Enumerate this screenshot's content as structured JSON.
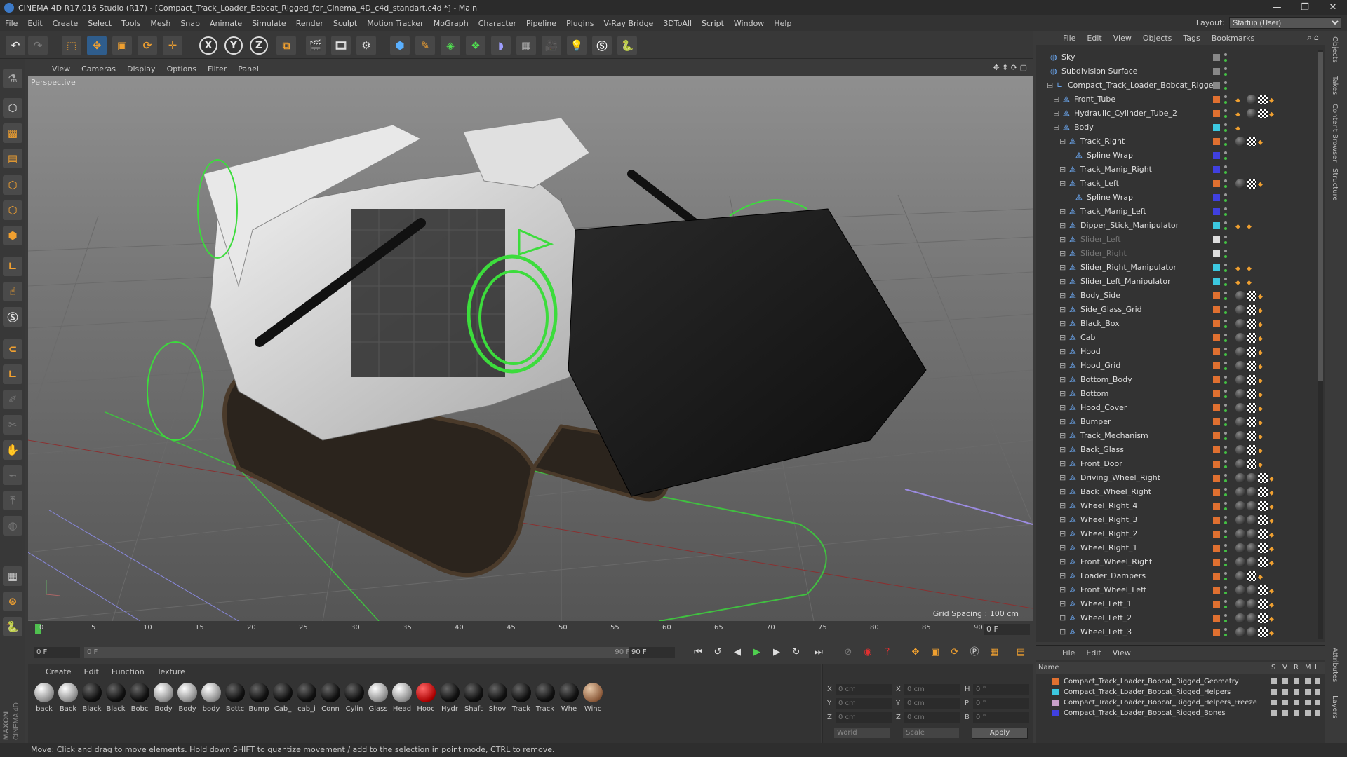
{
  "window": {
    "title": "CINEMA 4D R17.016 Studio (R17) - [Compact_Track_Loader_Bobcat_Rigged_for_Cinema_4D_c4d_standart.c4d *] - Main",
    "controls": [
      "—",
      "❐",
      "✕"
    ]
  },
  "menubar": {
    "items": [
      "File",
      "Edit",
      "Create",
      "Select",
      "Tools",
      "Mesh",
      "Snap",
      "Animate",
      "Simulate",
      "Render",
      "Sculpt",
      "Motion Tracker",
      "MoGraph",
      "Character",
      "Pipeline",
      "Plugins",
      "V-Ray Bridge",
      "3DToAll",
      "Script",
      "Window",
      "Help"
    ],
    "layout_label": "Layout:",
    "layout_value": "Startup (User)"
  },
  "toolbar": {
    "axis_x": "X",
    "axis_y": "Y",
    "axis_z": "Z"
  },
  "viewport": {
    "menu": [
      "View",
      "Cameras",
      "Display",
      "Options",
      "Filter",
      "Panel"
    ],
    "label": "Perspective",
    "grid_spacing": "Grid Spacing : 100 cm"
  },
  "timeline": {
    "ticks": [
      "0",
      "5",
      "10",
      "15",
      "20",
      "25",
      "30",
      "35",
      "40",
      "45",
      "50",
      "55",
      "60",
      "65",
      "70",
      "75",
      "80",
      "85",
      "90"
    ],
    "current_frame": "0 F",
    "start_field": "0 F",
    "range_start": "0 F",
    "range_end": "90 F",
    "end_field": "90 F"
  },
  "materials": {
    "menu": [
      "Create",
      "Edit",
      "Function",
      "Texture"
    ],
    "items": [
      {
        "name": "back",
        "style": "light"
      },
      {
        "name": "Back",
        "style": "light"
      },
      {
        "name": "Black",
        "style": "dark"
      },
      {
        "name": "Black",
        "style": "dark"
      },
      {
        "name": "Bobc",
        "style": "dark"
      },
      {
        "name": "Body",
        "style": "light"
      },
      {
        "name": "Body",
        "style": "light"
      },
      {
        "name": "body",
        "style": "light"
      },
      {
        "name": "Bottc",
        "style": "dark"
      },
      {
        "name": "Bump",
        "style": "dark"
      },
      {
        "name": "Cab_",
        "style": "dark"
      },
      {
        "name": "cab_i",
        "style": "dark"
      },
      {
        "name": "Conn",
        "style": "dark"
      },
      {
        "name": "Cylin",
        "style": "dark"
      },
      {
        "name": "Glass",
        "style": "light"
      },
      {
        "name": "Head",
        "style": "light"
      },
      {
        "name": "Hooc",
        "style": "red"
      },
      {
        "name": "Hydr",
        "style": "dark"
      },
      {
        "name": "Shaft",
        "style": "dark"
      },
      {
        "name": "Shov",
        "style": "dark"
      },
      {
        "name": "Track",
        "style": "dark"
      },
      {
        "name": "Track",
        "style": "dark"
      },
      {
        "name": "Whe",
        "style": "dark"
      },
      {
        "name": "Winc",
        "style": "skin"
      }
    ]
  },
  "coords": {
    "x_label": "X",
    "y_label": "Y",
    "z_label": "Z",
    "x2_label": "X",
    "y2_label": "Y",
    "z2_label": "Z",
    "h_label": "H",
    "p_label": "P",
    "b_label": "B",
    "x": "0 cm",
    "y": "0 cm",
    "z": "0 cm",
    "sx": "0 cm",
    "sy": "0 cm",
    "sz": "0 cm",
    "h": "0 °",
    "p": "0 °",
    "b": "0 °",
    "mode": "World",
    "scale": "Scale",
    "apply": "Apply"
  },
  "objects": {
    "menu": [
      "File",
      "Edit",
      "View",
      "Objects",
      "Tags",
      "Bookmarks"
    ],
    "rows": [
      {
        "label": "Sky",
        "indent": 0,
        "dim": false,
        "color": "#888888",
        "tags": []
      },
      {
        "label": "Subdivision Surface",
        "indent": 0,
        "dim": false,
        "color": "#888888",
        "tags": []
      },
      {
        "label": "Compact_Track_Loader_Bobcat_Rigged",
        "indent": 1,
        "dim": false,
        "color": "#888888",
        "tags": []
      },
      {
        "label": "Front_Tube",
        "indent": 2,
        "dim": false,
        "color": "#e07030",
        "tags": [
          "tri",
          "ball",
          "ck",
          "tri"
        ]
      },
      {
        "label": "Hydraulic_Cylinder_Tube_2",
        "indent": 2,
        "dim": false,
        "color": "#e07030",
        "tags": [
          "tri",
          "ball",
          "ck",
          "tri"
        ]
      },
      {
        "label": "Body",
        "indent": 2,
        "dim": false,
        "color": "#3cc8e0",
        "tags": [
          "tri"
        ]
      },
      {
        "label": "Track_Right",
        "indent": 3,
        "dim": false,
        "color": "#e07030",
        "tags": [
          "ball",
          "ck",
          "tri"
        ]
      },
      {
        "label": "Spline Wrap",
        "indent": 4,
        "dim": false,
        "color": "#4040e0",
        "tags": []
      },
      {
        "label": "Track_Manip_Right",
        "indent": 3,
        "dim": false,
        "color": "#4040e0",
        "tags": []
      },
      {
        "label": "Track_Left",
        "indent": 3,
        "dim": false,
        "color": "#e07030",
        "tags": [
          "ball",
          "ck",
          "tri"
        ]
      },
      {
        "label": "Spline Wrap",
        "indent": 4,
        "dim": false,
        "color": "#4040e0",
        "tags": []
      },
      {
        "label": "Track_Manip_Left",
        "indent": 3,
        "dim": false,
        "color": "#4040e0",
        "tags": []
      },
      {
        "label": "Dipper_Stick_Manipulator",
        "indent": 3,
        "dim": false,
        "color": "#3cc8e0",
        "tags": [
          "tri",
          "tri"
        ]
      },
      {
        "label": "Slider_Left",
        "indent": 3,
        "dim": true,
        "color": "#dddddd",
        "tags": []
      },
      {
        "label": "Slider_Right",
        "indent": 3,
        "dim": true,
        "color": "#dddddd",
        "tags": []
      },
      {
        "label": "Slider_Right_Manipulator",
        "indent": 3,
        "dim": false,
        "color": "#3cc8e0",
        "tags": [
          "tri",
          "tri"
        ]
      },
      {
        "label": "Slider_Left_Manipulator",
        "indent": 3,
        "dim": false,
        "color": "#3cc8e0",
        "tags": [
          "tri",
          "tri"
        ]
      },
      {
        "label": "Body_Side",
        "indent": 3,
        "dim": false,
        "color": "#e07030",
        "tags": [
          "ball",
          "ck",
          "tri"
        ]
      },
      {
        "label": "Side_Glass_Grid",
        "indent": 3,
        "dim": false,
        "color": "#e07030",
        "tags": [
          "ball",
          "ck",
          "tri"
        ]
      },
      {
        "label": "Black_Box",
        "indent": 3,
        "dim": false,
        "color": "#e07030",
        "tags": [
          "ball",
          "ck",
          "tri"
        ]
      },
      {
        "label": "Cab",
        "indent": 3,
        "dim": false,
        "color": "#e07030",
        "tags": [
          "ball",
          "ck",
          "tri"
        ]
      },
      {
        "label": "Hood",
        "indent": 3,
        "dim": false,
        "color": "#e07030",
        "tags": [
          "ball",
          "ck",
          "tri"
        ]
      },
      {
        "label": "Hood_Grid",
        "indent": 3,
        "dim": false,
        "color": "#e07030",
        "tags": [
          "ball",
          "ck",
          "tri"
        ]
      },
      {
        "label": "Bottom_Body",
        "indent": 3,
        "dim": false,
        "color": "#e07030",
        "tags": [
          "ball",
          "ck",
          "tri"
        ]
      },
      {
        "label": "Bottom",
        "indent": 3,
        "dim": false,
        "color": "#e07030",
        "tags": [
          "ball",
          "ck",
          "tri"
        ]
      },
      {
        "label": "Hood_Cover",
        "indent": 3,
        "dim": false,
        "color": "#e07030",
        "tags": [
          "ball",
          "ck",
          "tri"
        ]
      },
      {
        "label": "Bumper",
        "indent": 3,
        "dim": false,
        "color": "#e07030",
        "tags": [
          "ball",
          "ck",
          "tri"
        ]
      },
      {
        "label": "Track_Mechanism",
        "indent": 3,
        "dim": false,
        "color": "#e07030",
        "tags": [
          "ball",
          "ck",
          "tri"
        ]
      },
      {
        "label": "Back_Glass",
        "indent": 3,
        "dim": false,
        "color": "#e07030",
        "tags": [
          "ball",
          "ck",
          "tri"
        ]
      },
      {
        "label": "Front_Door",
        "indent": 3,
        "dim": false,
        "color": "#e07030",
        "tags": [
          "ball",
          "ck",
          "tri"
        ]
      },
      {
        "label": "Driving_Wheel_Right",
        "indent": 3,
        "dim": false,
        "color": "#e07030",
        "tags": [
          "ball",
          "ball",
          "ck",
          "tri"
        ]
      },
      {
        "label": "Back_Wheel_Right",
        "indent": 3,
        "dim": false,
        "color": "#e07030",
        "tags": [
          "ball",
          "ball",
          "ck",
          "tri"
        ]
      },
      {
        "label": "Wheel_Right_4",
        "indent": 3,
        "dim": false,
        "color": "#e07030",
        "tags": [
          "ball",
          "ball",
          "ck",
          "tri"
        ]
      },
      {
        "label": "Wheel_Right_3",
        "indent": 3,
        "dim": false,
        "color": "#e07030",
        "tags": [
          "ball",
          "ball",
          "ck",
          "tri"
        ]
      },
      {
        "label": "Wheel_Right_2",
        "indent": 3,
        "dim": false,
        "color": "#e07030",
        "tags": [
          "ball",
          "ball",
          "ck",
          "tri"
        ]
      },
      {
        "label": "Wheel_Right_1",
        "indent": 3,
        "dim": false,
        "color": "#e07030",
        "tags": [
          "ball",
          "ball",
          "ck",
          "tri"
        ]
      },
      {
        "label": "Front_Wheel_Right",
        "indent": 3,
        "dim": false,
        "color": "#e07030",
        "tags": [
          "ball",
          "ball",
          "ck",
          "tri"
        ]
      },
      {
        "label": "Loader_Dampers",
        "indent": 3,
        "dim": false,
        "color": "#e07030",
        "tags": [
          "ball",
          "ck",
          "tri"
        ]
      },
      {
        "label": "Front_Wheel_Left",
        "indent": 3,
        "dim": false,
        "color": "#e07030",
        "tags": [
          "ball",
          "ball",
          "ck",
          "tri"
        ]
      },
      {
        "label": "Wheel_Left_1",
        "indent": 3,
        "dim": false,
        "color": "#e07030",
        "tags": [
          "ball",
          "ball",
          "ck",
          "tri"
        ]
      },
      {
        "label": "Wheel_Left_2",
        "indent": 3,
        "dim": false,
        "color": "#e07030",
        "tags": [
          "ball",
          "ball",
          "ck",
          "tri"
        ]
      },
      {
        "label": "Wheel_Left_3",
        "indent": 3,
        "dim": false,
        "color": "#e07030",
        "tags": [
          "ball",
          "ball",
          "ck",
          "tri"
        ]
      }
    ]
  },
  "layers": {
    "menu": [
      "File",
      "Edit",
      "View"
    ],
    "header_name": "Name",
    "header_cols": [
      "S",
      "V",
      "R",
      "M",
      "L"
    ],
    "rows": [
      {
        "label": "Compact_Track_Loader_Bobcat_Rigged_Geometry",
        "color": "#e07030"
      },
      {
        "label": "Compact_Track_Loader_Bobcat_Rigged_Helpers",
        "color": "#3cc8e0"
      },
      {
        "label": "Compact_Track_Loader_Bobcat_Rigged_Helpers_Freeze",
        "color": "#c8a0c8"
      },
      {
        "label": "Compact_Track_Loader_Bobcat_Rigged_Bones",
        "color": "#4040e0"
      }
    ]
  },
  "side_tabs": [
    "Objects",
    "Takes",
    "Content Browser",
    "Structure",
    "Attributes",
    "Layers"
  ],
  "brand": {
    "line1": "MAXON",
    "line2": "CINEMA 4D"
  },
  "status": "Move: Click and drag to move elements. Hold down SHIFT to quantize movement / add to the selection in point mode, CTRL to remove."
}
